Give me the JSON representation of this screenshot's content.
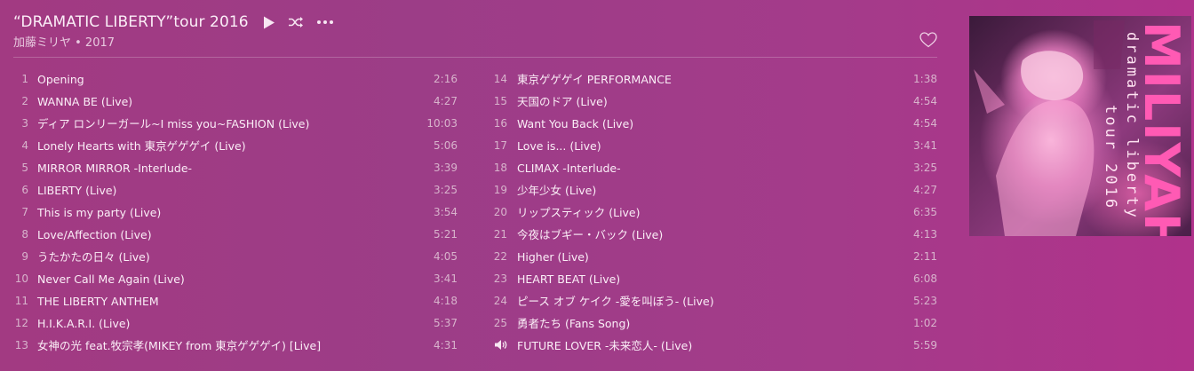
{
  "album": {
    "title": "“DRAMATIC LIBERTY”tour 2016",
    "subtitle": "加藤ミリヤ • 2017"
  },
  "controls": {
    "play_icon": "play-icon",
    "shuffle_icon": "shuffle-icon",
    "more_icon": "more-icon",
    "heart_icon": "heart-icon"
  },
  "tracks_left": [
    {
      "num": "1",
      "title": "Opening",
      "duration": "2:16"
    },
    {
      "num": "2",
      "title": "WANNA BE (Live)",
      "duration": "4:27"
    },
    {
      "num": "3",
      "title": "ディア ロンリーガール~I miss you~FASHION (Live)",
      "duration": "10:03"
    },
    {
      "num": "4",
      "title": "Lonely Hearts with 東京ゲゲゲイ (Live)",
      "duration": "5:06"
    },
    {
      "num": "5",
      "title": "MIRROR MIRROR -Interlude-",
      "duration": "3:39"
    },
    {
      "num": "6",
      "title": "LIBERTY (Live)",
      "duration": "3:25"
    },
    {
      "num": "7",
      "title": "This is my party (Live)",
      "duration": "3:54"
    },
    {
      "num": "8",
      "title": "Love/Affection (Live)",
      "duration": "5:21"
    },
    {
      "num": "9",
      "title": "うたかたの日々 (Live)",
      "duration": "4:05"
    },
    {
      "num": "10",
      "title": "Never Call Me Again (Live)",
      "duration": "3:41"
    },
    {
      "num": "11",
      "title": "THE LIBERTY ANTHEM",
      "duration": "4:18"
    },
    {
      "num": "12",
      "title": "H.I.K.A.R.I. (Live)",
      "duration": "5:37"
    },
    {
      "num": "13",
      "title": "女神の光 feat.牧宗孝(MIKEY from 東京ゲゲゲイ) [Live]",
      "duration": "4:31"
    }
  ],
  "tracks_right": [
    {
      "num": "14",
      "title": "東京ゲゲゲイ PERFORMANCE",
      "duration": "1:38"
    },
    {
      "num": "15",
      "title": "天国のドア (Live)",
      "duration": "4:54"
    },
    {
      "num": "16",
      "title": "Want You Back (Live)",
      "duration": "4:54"
    },
    {
      "num": "17",
      "title": "Love is... (Live)",
      "duration": "3:41"
    },
    {
      "num": "18",
      "title": "CLIMAX -Interlude-",
      "duration": "3:25"
    },
    {
      "num": "19",
      "title": "少年少女 (Live)",
      "duration": "4:27"
    },
    {
      "num": "20",
      "title": "リップスティック (Live)",
      "duration": "6:35"
    },
    {
      "num": "21",
      "title": "今夜はブギー・バック (Live)",
      "duration": "4:13"
    },
    {
      "num": "22",
      "title": "Higher (Live)",
      "duration": "2:11"
    },
    {
      "num": "23",
      "title": "HEART BEAT (Live)",
      "duration": "6:08"
    },
    {
      "num": "24",
      "title": "ピース オブ ケイク -愛を叫ぼう- (Live)",
      "duration": "5:23"
    },
    {
      "num": "25",
      "title": "勇者たち (Fans Song)",
      "duration": "1:02"
    },
    {
      "num": "",
      "title": "FUTURE LOVER -未来恋人- (Live)",
      "duration": "5:59",
      "now_playing": true,
      "icon": "speaker-icon"
    }
  ],
  "cover": {
    "text_line1": "dramatic liberty",
    "text_line2": "tour 2016",
    "text_big": "MILIYAH",
    "colors": {
      "accent": "#ff5ab4"
    }
  }
}
